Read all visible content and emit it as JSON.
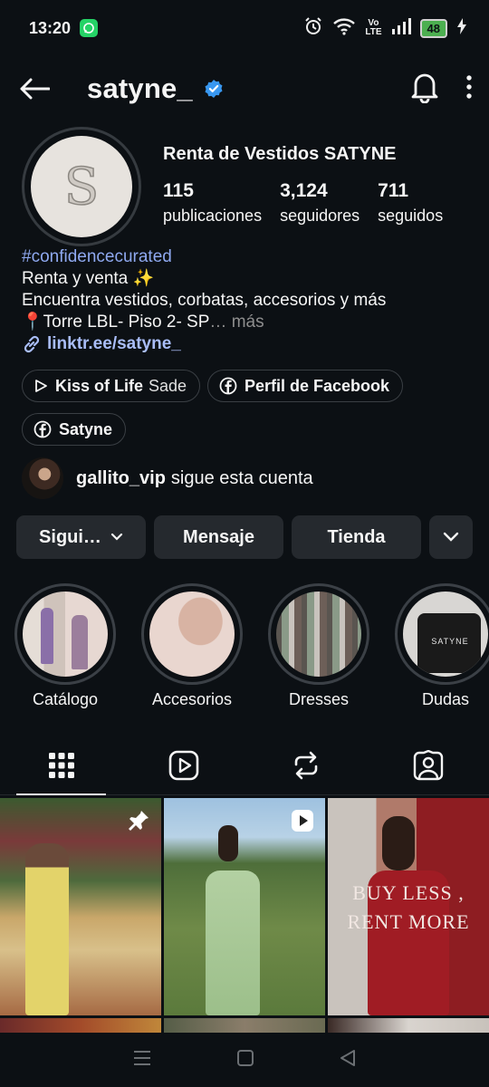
{
  "status_bar": {
    "time": "13:20",
    "volte_top": "Vo",
    "volte_bottom": "LTE",
    "battery": "48"
  },
  "header": {
    "username": "satyne_"
  },
  "profile": {
    "avatar_letter": "S",
    "display_name": "Renta de Vestidos SATYNE",
    "stats": [
      {
        "value": "115",
        "label": "publicaciones"
      },
      {
        "value": "3,124",
        "label": "seguidores"
      },
      {
        "value": "711",
        "label": "seguidos"
      }
    ]
  },
  "bio": {
    "hashtag": "#confidencecurated",
    "line1": "Renta y venta ✨",
    "line2": "Encuentra vestidos, corbatas, accesorios y más",
    "line3": "📍Torre LBL- Piso 2- SP",
    "ellipsis": "…",
    "more": "más",
    "link": "linktr.ee/satyne_"
  },
  "chips": {
    "music_title": "Kiss of Life",
    "music_artist": "Sade",
    "facebook_profile": "Perfil de Facebook",
    "facebook_name": "Satyne"
  },
  "followed_by": {
    "username": "gallito_vip",
    "text": "sigue esta cuenta"
  },
  "actions": {
    "follow": "Sigui…",
    "message": "Mensaje",
    "shop": "Tienda"
  },
  "highlights": [
    {
      "label": "Catálogo"
    },
    {
      "label": "Accesorios"
    },
    {
      "label": "Dresses"
    },
    {
      "label": "Dudas",
      "image_text": "SATYNE"
    }
  ],
  "posts": [
    {
      "icon": "pin-icon"
    },
    {
      "icon": "reel-icon"
    },
    {
      "line1": "BUY LESS ,",
      "line2": "RENT MORE"
    }
  ],
  "colors": {
    "background": "#0c1014",
    "link": "#a9bdf7",
    "hashtag": "#8fa9f0",
    "verified": "#3897f0",
    "button": "#25292e"
  }
}
